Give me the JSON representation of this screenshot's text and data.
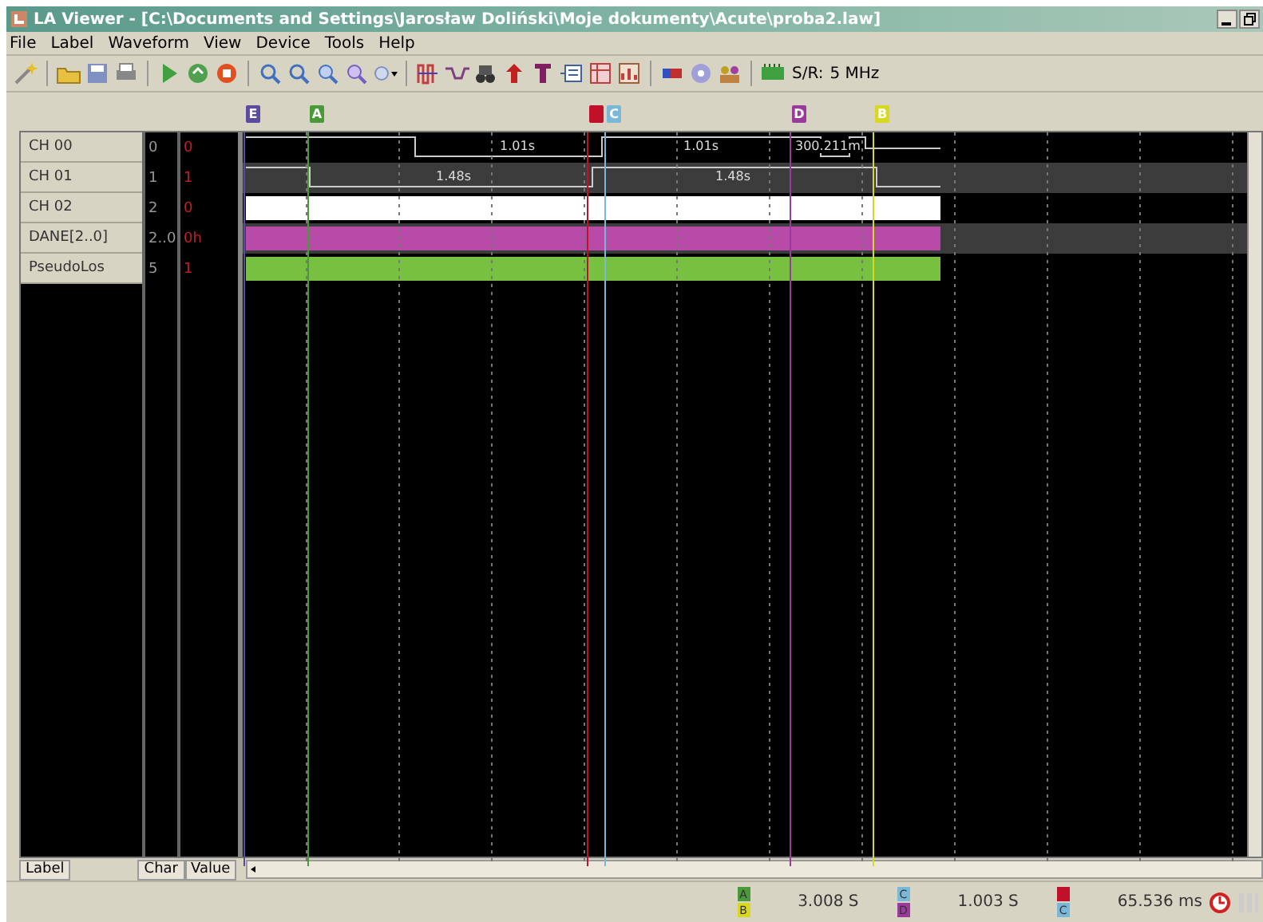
{
  "window": {
    "title": "LA Viewer - [C:\\Documents and Settings\\Jarosław Doliński\\Moje dokumenty\\Acute\\proba2.law]"
  },
  "menu": [
    "File",
    "Label",
    "Waveform",
    "View",
    "Device",
    "Tools",
    "Help"
  ],
  "toolbar": {
    "sample_rate_label": "S/R:",
    "sample_rate": "5 MHz"
  },
  "markers": [
    {
      "letter": "E",
      "color": "#5a4aa0"
    },
    {
      "letter": "A",
      "color": "#4a9a3a"
    },
    {
      "color": "#c0102a"
    },
    {
      "letter": "C",
      "color": "#7ab8d8"
    },
    {
      "letter": "D",
      "color": "#9a3a9a"
    },
    {
      "letter": "B",
      "color": "#d8d820"
    }
  ],
  "signals": [
    {
      "label": "CH 00",
      "char": "0",
      "value": "0",
      "kind": "line",
      "shaded": false,
      "spans": [
        "1.01s",
        "1.01s",
        "300.211m"
      ]
    },
    {
      "label": "CH 01",
      "char": "1",
      "value": "1",
      "kind": "line",
      "shaded": true,
      "spans": [
        "1.48s",
        "1.48s"
      ]
    },
    {
      "label": "CH 02",
      "char": "2",
      "value": "0",
      "kind": "bar",
      "shaded": false,
      "color": "#ffffff"
    },
    {
      "label": "DANE[2..0]",
      "char": "2..0",
      "value": "0h",
      "kind": "bar",
      "shaded": true,
      "color": "#b84aa8"
    },
    {
      "label": "PseudoLos",
      "char": "5",
      "value": "1",
      "kind": "bar",
      "shaded": false,
      "color": "#78c040"
    }
  ],
  "column_headers": [
    "Label",
    "Char",
    "Value"
  ],
  "status": [
    {
      "markers": [
        {
          "letter": "A",
          "color": "#4a9a3a"
        },
        {
          "letter": "B",
          "color": "#d8d820"
        }
      ],
      "reading": "3.008 S"
    },
    {
      "markers": [
        {
          "letter": "C",
          "color": "#7ab8d8"
        },
        {
          "letter": "D",
          "color": "#9a3a9a"
        }
      ],
      "reading": "1.003 S"
    },
    {
      "markers": [
        {
          "color": "#c0102a"
        },
        {
          "letter": "C",
          "color": "#7ab8d8"
        }
      ],
      "reading": "65.536 ms"
    }
  ]
}
